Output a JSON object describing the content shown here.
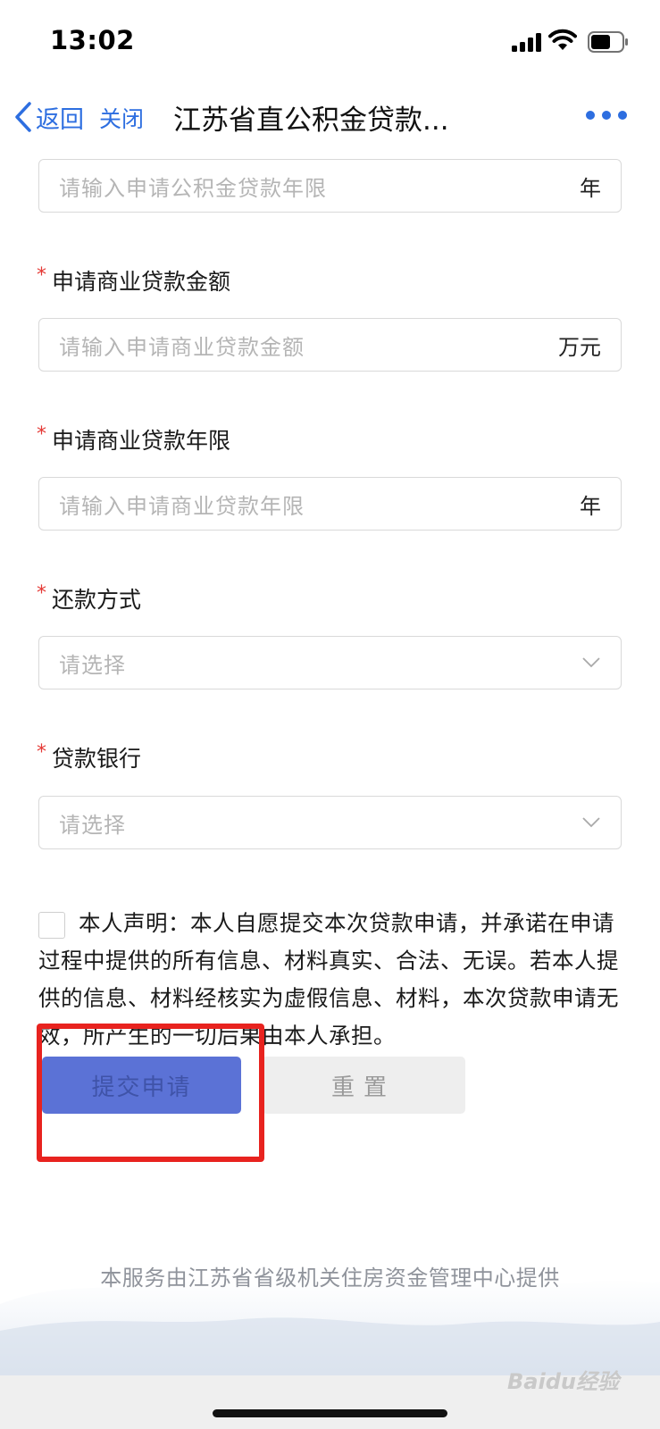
{
  "status_bar": {
    "time": "13:02"
  },
  "nav": {
    "back_label": "返回",
    "close_label": "关闭",
    "title": "江苏省直公积金贷款..."
  },
  "form": {
    "fund_term": {
      "placeholder": "请输入申请公积金贷款年限",
      "unit": "年"
    },
    "commercial_amount": {
      "label": "申请商业贷款金额",
      "placeholder": "请输入申请商业贷款金额",
      "unit": "万元"
    },
    "commercial_term": {
      "label": "申请商业贷款年限",
      "placeholder": "请输入申请商业贷款年限",
      "unit": "年"
    },
    "repayment": {
      "label": "还款方式",
      "placeholder": "请选择"
    },
    "bank": {
      "label": "贷款银行",
      "placeholder": "请选择"
    },
    "required_mark": "*"
  },
  "declaration": {
    "text": "本人声明：本人自愿提交本次贷款申请，并承诺在申请过程中提供的所有信息、材料真实、合法、无误。若本人提供的信息、材料经核实为虚假信息、材料，本次贷款申请无效，所产生的一切后果由本人承担。"
  },
  "buttons": {
    "submit": "提交申请",
    "reset": "重置"
  },
  "footer": {
    "text": "本服务由江苏省省级机关住房资金管理中心提供"
  },
  "watermark": "Baidu经验",
  "colors": {
    "accent": "#2d6ee0",
    "submit": "#5b72d6",
    "required": "#e53935",
    "highlight": "#e8231f"
  }
}
